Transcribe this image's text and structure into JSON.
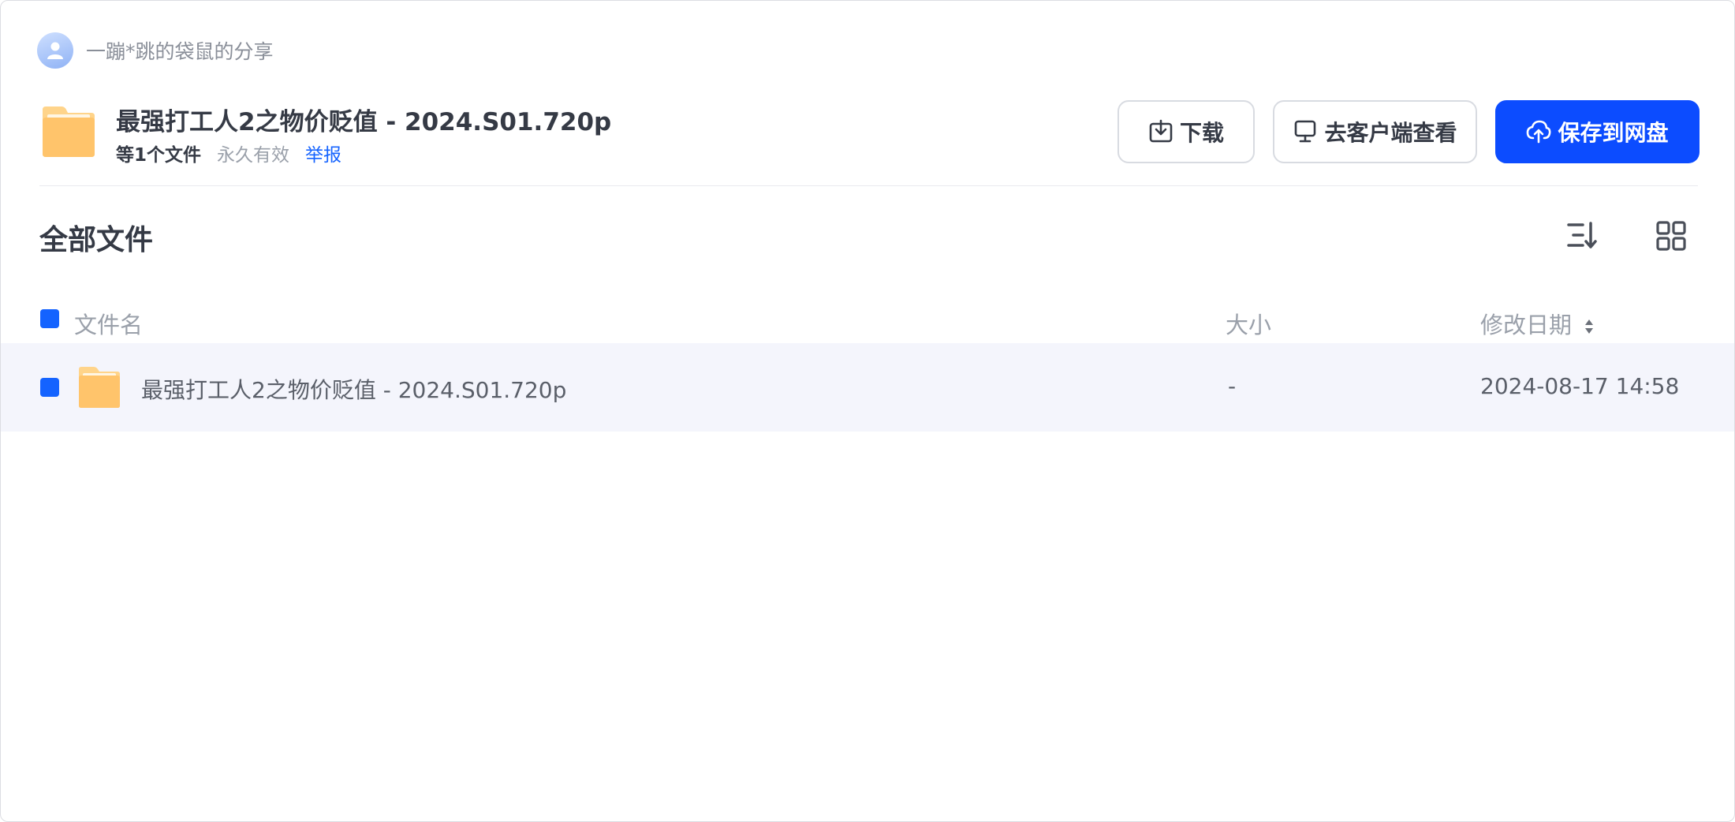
{
  "sharer": {
    "name": "一蹦*跳的袋鼠的分享",
    "avatar_icon": "user-icon"
  },
  "share": {
    "title": "最强打工人2之物价贬值 - 2024.S01.720p",
    "file_count": "等1个文件",
    "validity": "永久有效",
    "report_label": "举报",
    "folder_icon": "folder-icon"
  },
  "actions": {
    "download_label": "下载",
    "client_label": "去客户端查看",
    "save_label": "保存到网盘"
  },
  "section": {
    "title": "全部文件",
    "sort_icon": "sort-icon",
    "grid_icon": "grid-view-icon"
  },
  "table": {
    "headers": {
      "name": "文件名",
      "size": "大小",
      "modified": "修改日期"
    },
    "rows": [
      {
        "name": "最强打工人2之物价贬值 - 2024.S01.720p",
        "size": "-",
        "modified": "2024-08-17 14:58",
        "icon": "folder-icon"
      }
    ]
  },
  "colors": {
    "accent": "#0c4cff",
    "link": "#1664ff",
    "row_highlight": "#f4f5fc",
    "folder": "#ffc46b"
  }
}
